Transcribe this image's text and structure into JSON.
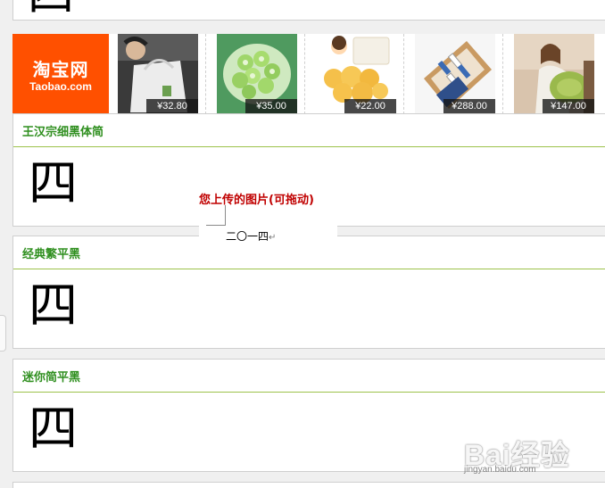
{
  "top_panel": {
    "glyph": "四"
  },
  "ad_strip": {
    "logo": {
      "text_cn": "淘宝网",
      "text_en": "Taobao.com",
      "color": "#ff5000"
    },
    "products": [
      {
        "name": "tote-bag",
        "price": "¥32.80"
      },
      {
        "name": "green-okra-snack",
        "price": "¥35.00"
      },
      {
        "name": "puff-cookies",
        "price": "¥22.00"
      },
      {
        "name": "boxed-gift-set",
        "price": "¥288.00"
      },
      {
        "name": "woman-with-pillow",
        "price": "¥147.00"
      }
    ]
  },
  "font_panels": [
    {
      "title": "王汉宗细黑体简",
      "glyph": "四"
    },
    {
      "title": "经典繁平黑",
      "glyph": "四"
    },
    {
      "title": "迷你简平黑",
      "glyph": "四"
    }
  ],
  "upload": {
    "label": "您上传的图片(可拖动)",
    "sample_text": "二〇一四",
    "return_mark": "↵"
  },
  "watermark": {
    "logo": "Bai经验",
    "url": "jingyan.baidu.com"
  },
  "colors": {
    "title_green": "#2f8f1f",
    "rule_green": "#9cc24a",
    "upload_red": "#c00000"
  }
}
